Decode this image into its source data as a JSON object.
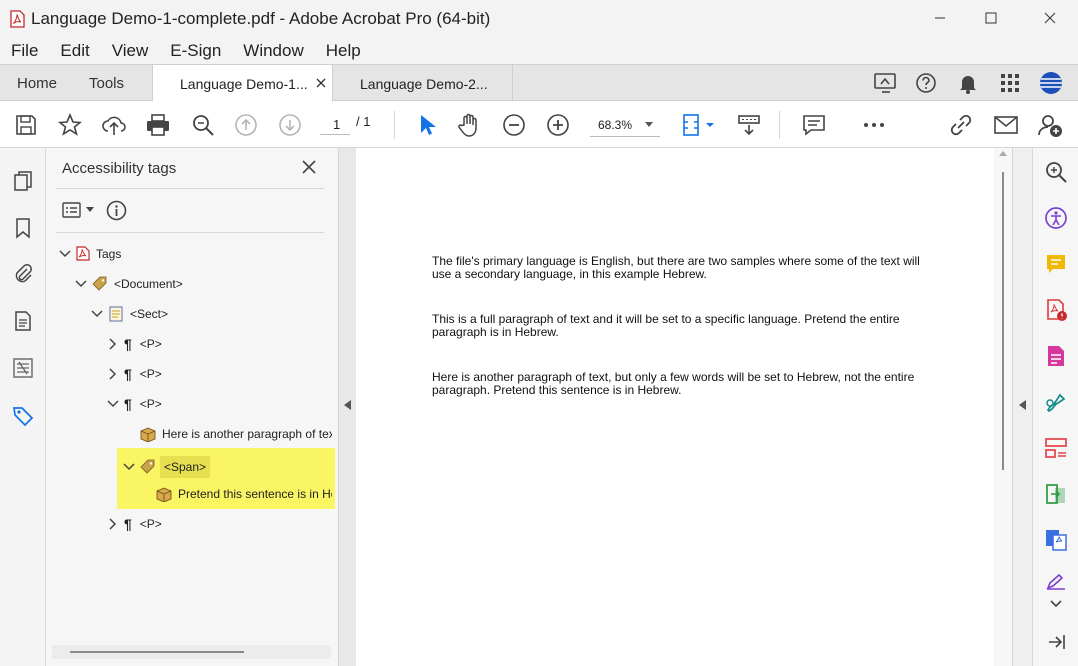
{
  "window": {
    "title": "Language Demo-1-complete.pdf - Adobe Acrobat Pro (64-bit)"
  },
  "menu": [
    "File",
    "Edit",
    "View",
    "E-Sign",
    "Window",
    "Help"
  ],
  "tabs": {
    "home": "Home",
    "tools": "Tools",
    "doc1": "Language Demo-1...",
    "doc2": "Language Demo-2..."
  },
  "toolbar": {
    "page_current": "1",
    "page_total": "/ 1",
    "zoom": "68.3%"
  },
  "panel": {
    "title": "Accessibility tags",
    "tree": {
      "tags": "Tags",
      "document": "<Document>",
      "sect": "<Sect>",
      "p1": "<P>",
      "p2": "<P>",
      "p3": "<P>",
      "p3_text": "Here is another paragraph of tex",
      "span": "<Span>",
      "span_text": "Pretend this sentence is in He",
      "p4": "<P>"
    }
  },
  "document": {
    "paragraphs": [
      "The file's primary language is English, but there are two samples where some of the text will use a secondary language, in this example Hebrew.",
      "This is a full paragraph of text and it will be set to a specific language. Pretend the entire paragraph is in Hebrew.",
      "Here is another paragraph of text, but only a few words will be set to Hebrew, not the entire paragraph. Pretend this sentence is in Hebrew."
    ]
  },
  "colors": {
    "highlight": "#faf562",
    "tool_blue": "#1473e6",
    "accent_purple": "#7b3fd1"
  }
}
